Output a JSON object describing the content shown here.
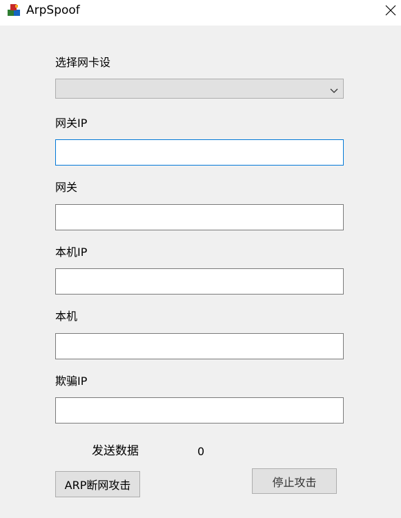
{
  "window": {
    "title": "ArpSpoof",
    "icons": {
      "app": "app-cubes-icon",
      "close": "close-icon"
    }
  },
  "form": {
    "adapter_label": "选择网卡设",
    "adapter_selected": "",
    "gateway_ip_label": "网关IP",
    "gateway_ip_value": "",
    "gateway_label": "网关",
    "gateway_value": "",
    "local_ip_label": "本机IP",
    "local_ip_value": "",
    "local_label": "本机",
    "local_value": "",
    "spoof_ip_label": "欺骗IP",
    "spoof_ip_value": ""
  },
  "status": {
    "sent_label": "发送数据",
    "sent_count": "0"
  },
  "buttons": {
    "attack": "ARP断网攻击",
    "stop": "停止攻击"
  },
  "colors": {
    "background": "#f0f0f0",
    "focus_border": "#0078d7",
    "button_face": "#e1e1e1"
  }
}
